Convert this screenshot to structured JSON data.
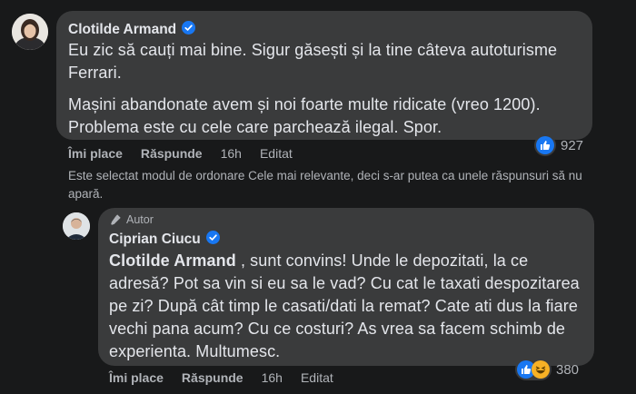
{
  "comment1": {
    "author": "Clotilde Armand",
    "paragraph1": "Eu zic să cauți mai bine. Sigur găsești și la tine câteva autoturisme Ferrari.",
    "paragraph2": "Mașini abandonate avem și noi foarte multe ridicate (vreo 1200). Problema este cu cele care parchează ilegal. Spor.",
    "actions": {
      "like": "Îmi place",
      "reply": "Răspunde",
      "time": "16h",
      "edited": "Editat"
    },
    "reactions": {
      "count": "927",
      "types": [
        "like-icon"
      ]
    }
  },
  "notice": "Este selectat modul de ordonare Cele mai relevante, deci s-ar putea ca unele răspunsuri să nu apară.",
  "comment2": {
    "author_badge": "Autor",
    "author": "Ciprian Ciucu",
    "mention": "Clotilde Armand",
    "text": " , sunt convins! Unde le depozitati, la ce adresă? Pot sa vin si eu sa le vad? Cu cat le taxati despozitarea pe zi? După cât timp le casati/dati la remat? Cate ati dus la fiare vechi pana acum? Cu ce costuri? As vrea sa facem schimb de experienta. Multumesc.",
    "actions": {
      "like": "Îmi place",
      "reply": "Răspunde",
      "time": "16h",
      "edited": "Editat"
    },
    "reactions": {
      "count": "380",
      "types": [
        "like-icon",
        "haha-icon"
      ]
    }
  },
  "colors": {
    "background": "#18191a",
    "bubble": "#3a3b3c",
    "text": "#e4e6eb",
    "muted": "#b0b3b8",
    "verified": "#1877f2",
    "like": "#1877f2",
    "haha": "#f7b125"
  }
}
